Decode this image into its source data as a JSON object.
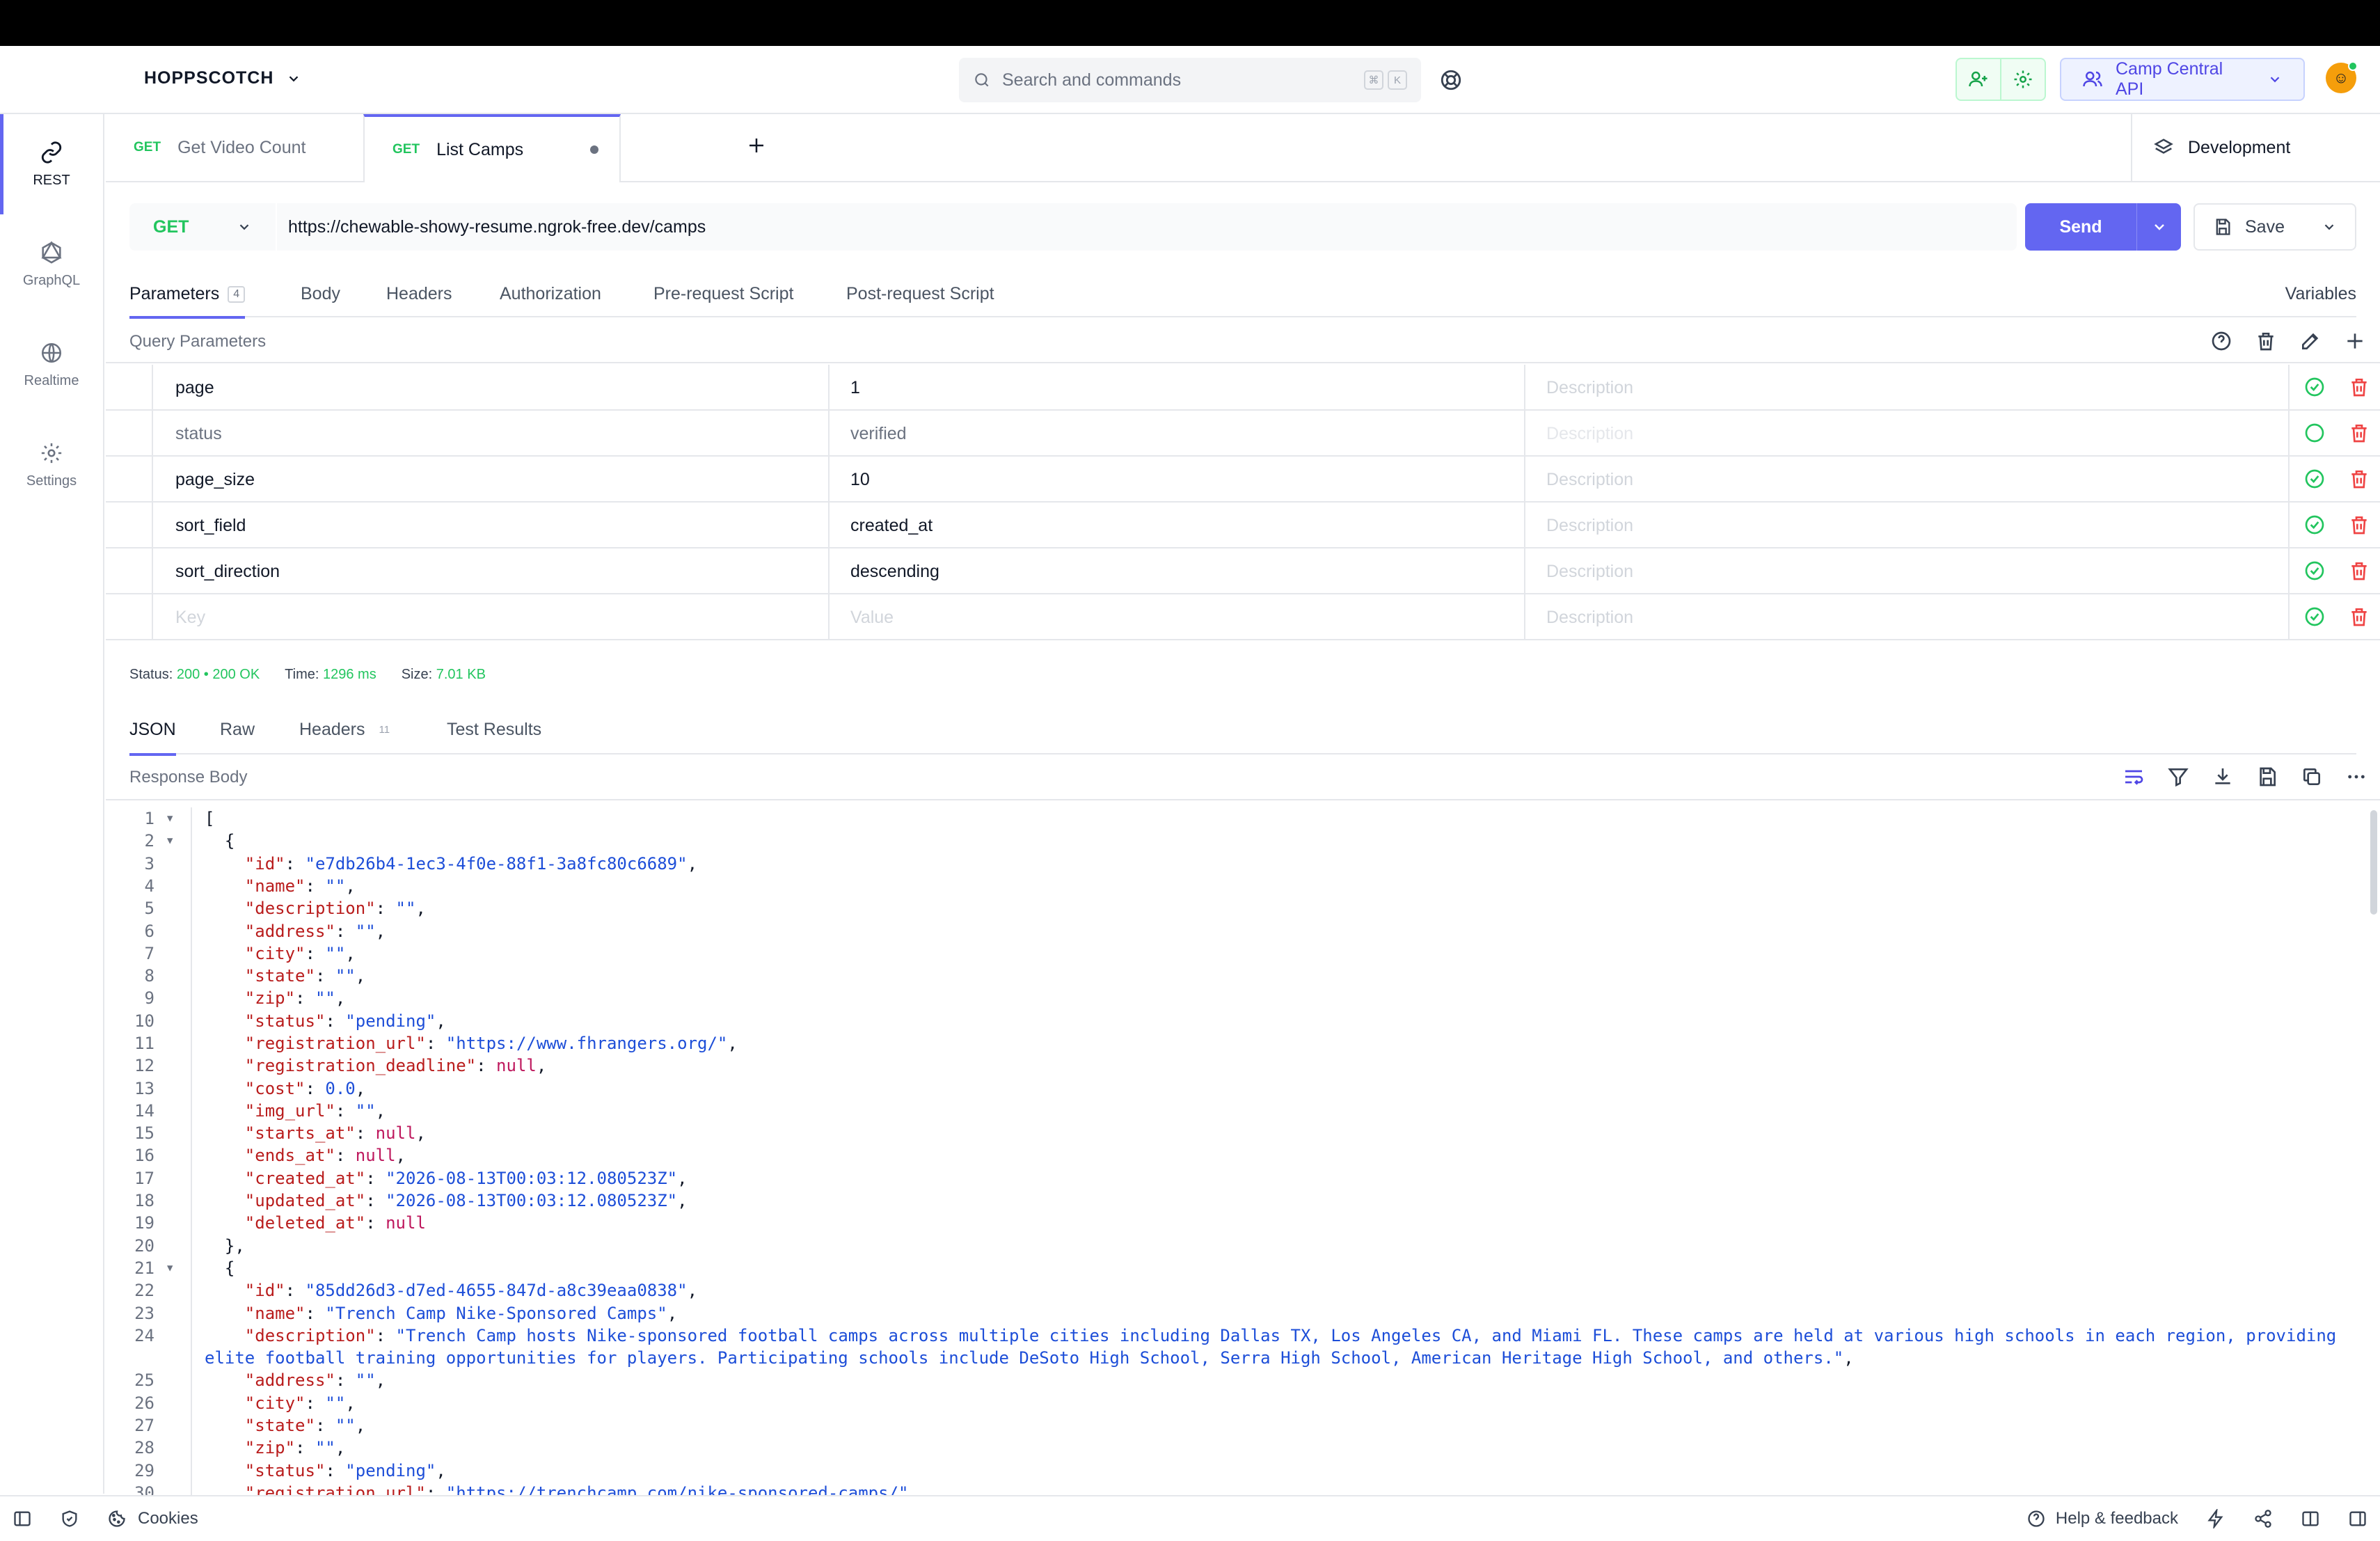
{
  "app": {
    "brand": "HOPPSCOTCH"
  },
  "search": {
    "placeholder": "Search and commands",
    "keys": [
      "⌘",
      "K"
    ]
  },
  "workspace": {
    "label": "Camp Central API"
  },
  "sidebar": {
    "items": [
      {
        "label": "REST",
        "icon": "link-icon",
        "active": true
      },
      {
        "label": "GraphQL",
        "icon": "graphql-icon"
      },
      {
        "label": "Realtime",
        "icon": "globe-icon"
      },
      {
        "label": "Settings",
        "icon": "gear-icon"
      }
    ]
  },
  "tabs": [
    {
      "method": "GET",
      "label": "Get Video Count"
    },
    {
      "method": "GET",
      "label": "List Camps",
      "active": true
    }
  ],
  "environment": {
    "label": "Development"
  },
  "request": {
    "method": "GET",
    "url": "https://chewable-showy-resume.ngrok-free.dev/camps",
    "send_label": "Send",
    "save_label": "Save"
  },
  "request_tabs": {
    "parameters": "Parameters",
    "parameters_count": "4",
    "body": "Body",
    "headers": "Headers",
    "authorization": "Authorization",
    "pre_request": "Pre-request Script",
    "post_request": "Post-request Script",
    "variables": "Variables"
  },
  "query_params": {
    "title": "Query Parameters",
    "rows": [
      {
        "key": "page",
        "value": "1",
        "description": "Description",
        "enabled": true
      },
      {
        "key": "status",
        "value": "verified",
        "description": "Description",
        "enabled": false
      },
      {
        "key": "page_size",
        "value": "10",
        "description": "Description",
        "enabled": true
      },
      {
        "key": "sort_field",
        "value": "created_at",
        "description": "Description",
        "enabled": true
      },
      {
        "key": "sort_direction",
        "value": "descending",
        "description": "Description",
        "enabled": true
      },
      {
        "key": "Key",
        "value": "Value",
        "description": "Description",
        "enabled": true,
        "placeholder": true
      }
    ]
  },
  "status_bar": {
    "status_label": "Status:",
    "status_code": "200",
    "status_text": "200 OK",
    "time_label": "Time:",
    "time_value": "1296 ms",
    "size_label": "Size:",
    "size_value": "7.01 KB"
  },
  "response_tabs": {
    "json": "JSON",
    "raw": "Raw",
    "headers": "Headers",
    "headers_count": "11",
    "tests": "Test Results"
  },
  "response_body": {
    "title": "Response Body",
    "lines": [
      {
        "n": "1",
        "fold": true,
        "tokens": [
          [
            "p",
            "["
          ]
        ]
      },
      {
        "n": "2",
        "fold": true,
        "tokens": [
          [
            "p",
            "  {"
          ]
        ]
      },
      {
        "n": "3",
        "tokens": [
          [
            "p",
            "    "
          ],
          [
            "k",
            "\"id\""
          ],
          [
            "p",
            ": "
          ],
          [
            "s",
            "\"e7db26b4-1ec3-4f0e-88f1-3a8fc80c6689\""
          ],
          [
            "p",
            ","
          ]
        ]
      },
      {
        "n": "4",
        "tokens": [
          [
            "p",
            "    "
          ],
          [
            "k",
            "\"name\""
          ],
          [
            "p",
            ": "
          ],
          [
            "s",
            "\"\""
          ],
          [
            "p",
            ","
          ]
        ]
      },
      {
        "n": "5",
        "tokens": [
          [
            "p",
            "    "
          ],
          [
            "k",
            "\"description\""
          ],
          [
            "p",
            ": "
          ],
          [
            "s",
            "\"\""
          ],
          [
            "p",
            ","
          ]
        ]
      },
      {
        "n": "6",
        "tokens": [
          [
            "p",
            "    "
          ],
          [
            "k",
            "\"address\""
          ],
          [
            "p",
            ": "
          ],
          [
            "s",
            "\"\""
          ],
          [
            "p",
            ","
          ]
        ]
      },
      {
        "n": "7",
        "tokens": [
          [
            "p",
            "    "
          ],
          [
            "k",
            "\"city\""
          ],
          [
            "p",
            ": "
          ],
          [
            "s",
            "\"\""
          ],
          [
            "p",
            ","
          ]
        ]
      },
      {
        "n": "8",
        "tokens": [
          [
            "p",
            "    "
          ],
          [
            "k",
            "\"state\""
          ],
          [
            "p",
            ": "
          ],
          [
            "s",
            "\"\""
          ],
          [
            "p",
            ","
          ]
        ]
      },
      {
        "n": "9",
        "tokens": [
          [
            "p",
            "    "
          ],
          [
            "k",
            "\"zip\""
          ],
          [
            "p",
            ": "
          ],
          [
            "s",
            "\"\""
          ],
          [
            "p",
            ","
          ]
        ]
      },
      {
        "n": "10",
        "tokens": [
          [
            "p",
            "    "
          ],
          [
            "k",
            "\"status\""
          ],
          [
            "p",
            ": "
          ],
          [
            "s",
            "\"pending\""
          ],
          [
            "p",
            ","
          ]
        ]
      },
      {
        "n": "11",
        "tokens": [
          [
            "p",
            "    "
          ],
          [
            "k",
            "\"registration_url\""
          ],
          [
            "p",
            ": "
          ],
          [
            "s",
            "\"https://www.fhrangers.org/\""
          ],
          [
            "p",
            ","
          ]
        ]
      },
      {
        "n": "12",
        "tokens": [
          [
            "p",
            "    "
          ],
          [
            "k",
            "\"registration_deadline\""
          ],
          [
            "p",
            ": "
          ],
          [
            "w",
            "null"
          ],
          [
            "p",
            ","
          ]
        ]
      },
      {
        "n": "13",
        "tokens": [
          [
            "p",
            "    "
          ],
          [
            "k",
            "\"cost\""
          ],
          [
            "p",
            ": "
          ],
          [
            "m",
            "0.0"
          ],
          [
            "p",
            ","
          ]
        ]
      },
      {
        "n": "14",
        "tokens": [
          [
            "p",
            "    "
          ],
          [
            "k",
            "\"img_url\""
          ],
          [
            "p",
            ": "
          ],
          [
            "s",
            "\"\""
          ],
          [
            "p",
            ","
          ]
        ]
      },
      {
        "n": "15",
        "tokens": [
          [
            "p",
            "    "
          ],
          [
            "k",
            "\"starts_at\""
          ],
          [
            "p",
            ": "
          ],
          [
            "w",
            "null"
          ],
          [
            "p",
            ","
          ]
        ]
      },
      {
        "n": "16",
        "tokens": [
          [
            "p",
            "    "
          ],
          [
            "k",
            "\"ends_at\""
          ],
          [
            "p",
            ": "
          ],
          [
            "w",
            "null"
          ],
          [
            "p",
            ","
          ]
        ]
      },
      {
        "n": "17",
        "tokens": [
          [
            "p",
            "    "
          ],
          [
            "k",
            "\"created_at\""
          ],
          [
            "p",
            ": "
          ],
          [
            "s",
            "\"2026-08-13T00:03:12.080523Z\""
          ],
          [
            "p",
            ","
          ]
        ]
      },
      {
        "n": "18",
        "tokens": [
          [
            "p",
            "    "
          ],
          [
            "k",
            "\"updated_at\""
          ],
          [
            "p",
            ": "
          ],
          [
            "s",
            "\"2026-08-13T00:03:12.080523Z\""
          ],
          [
            "p",
            ","
          ]
        ]
      },
      {
        "n": "19",
        "tokens": [
          [
            "p",
            "    "
          ],
          [
            "k",
            "\"deleted_at\""
          ],
          [
            "p",
            ": "
          ],
          [
            "w",
            "null"
          ]
        ]
      },
      {
        "n": "20",
        "tokens": [
          [
            "p",
            "  },"
          ]
        ]
      },
      {
        "n": "21",
        "fold": true,
        "tokens": [
          [
            "p",
            "  {"
          ]
        ]
      },
      {
        "n": "22",
        "tokens": [
          [
            "p",
            "    "
          ],
          [
            "k",
            "\"id\""
          ],
          [
            "p",
            ": "
          ],
          [
            "s",
            "\"85dd26d3-d7ed-4655-847d-a8c39eaa0838\""
          ],
          [
            "p",
            ","
          ]
        ]
      },
      {
        "n": "23",
        "tokens": [
          [
            "p",
            "    "
          ],
          [
            "k",
            "\"name\""
          ],
          [
            "p",
            ": "
          ],
          [
            "s",
            "\"Trench Camp Nike-Sponsored Camps\""
          ],
          [
            "p",
            ","
          ]
        ]
      },
      {
        "n": "24",
        "tokens": [
          [
            "p",
            "    "
          ],
          [
            "k",
            "\"description\""
          ],
          [
            "p",
            ": "
          ],
          [
            "s",
            "\"Trench Camp hosts Nike-sponsored football camps across multiple cities including Dallas TX, Los Angeles CA, and Miami FL. These camps are held at various high schools in each region, providing"
          ]
        ]
      },
      {
        "n": "",
        "tokens": [
          [
            "s",
            "elite football training opportunities for players. Participating schools include DeSoto High School, Serra High School, American Heritage High School, and others.\""
          ],
          [
            "p",
            ","
          ]
        ]
      },
      {
        "n": "25",
        "tokens": [
          [
            "p",
            "    "
          ],
          [
            "k",
            "\"address\""
          ],
          [
            "p",
            ": "
          ],
          [
            "s",
            "\"\""
          ],
          [
            "p",
            ","
          ]
        ]
      },
      {
        "n": "26",
        "tokens": [
          [
            "p",
            "    "
          ],
          [
            "k",
            "\"city\""
          ],
          [
            "p",
            ": "
          ],
          [
            "s",
            "\"\""
          ],
          [
            "p",
            ","
          ]
        ]
      },
      {
        "n": "27",
        "tokens": [
          [
            "p",
            "    "
          ],
          [
            "k",
            "\"state\""
          ],
          [
            "p",
            ": "
          ],
          [
            "s",
            "\"\""
          ],
          [
            "p",
            ","
          ]
        ]
      },
      {
        "n": "28",
        "tokens": [
          [
            "p",
            "    "
          ],
          [
            "k",
            "\"zip\""
          ],
          [
            "p",
            ": "
          ],
          [
            "s",
            "\"\""
          ],
          [
            "p",
            ","
          ]
        ]
      },
      {
        "n": "29",
        "tokens": [
          [
            "p",
            "    "
          ],
          [
            "k",
            "\"status\""
          ],
          [
            "p",
            ": "
          ],
          [
            "s",
            "\"pending\""
          ],
          [
            "p",
            ","
          ]
        ]
      },
      {
        "n": "30",
        "tokens": [
          [
            "p",
            "    "
          ],
          [
            "k",
            "\"registration_url\""
          ],
          [
            "p",
            ": "
          ],
          [
            "s",
            "\"https://trenchcamp.com/nike-sponsored-camps/\""
          ],
          [
            "p",
            ","
          ]
        ]
      }
    ]
  },
  "footer": {
    "cookies": "Cookies",
    "help": "Help & feedback"
  },
  "colors": {
    "accent": "#6366f1",
    "success": "#22c55e",
    "danger": "#ef4444"
  }
}
